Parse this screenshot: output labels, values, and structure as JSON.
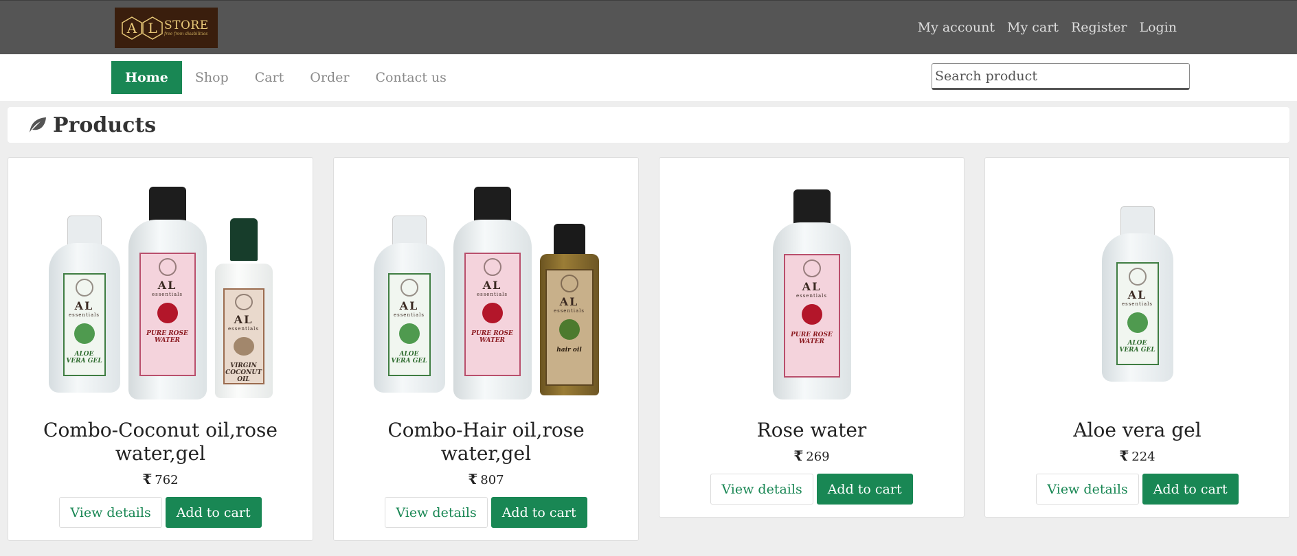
{
  "brand": {
    "logo_letters": [
      "A",
      "L"
    ],
    "logo_store": "STORE",
    "logo_tagline": "free from disabilities"
  },
  "account_links": [
    {
      "label": "My account"
    },
    {
      "label": "My cart"
    },
    {
      "label": "Register"
    },
    {
      "label": "Login"
    }
  ],
  "nav": {
    "items": [
      {
        "label": "Home",
        "active": true
      },
      {
        "label": "Shop"
      },
      {
        "label": "Cart"
      },
      {
        "label": "Order"
      },
      {
        "label": "Contact us"
      }
    ],
    "search_placeholder": "Search product"
  },
  "section": {
    "title": "Products",
    "icon": "leaf-icon"
  },
  "currency_symbol": "₹",
  "products": [
    {
      "title": "Combo-Coconut oil,rose water,gel",
      "price": "762",
      "view_label": "View details",
      "cart_label": "Add to cart"
    },
    {
      "title": "Combo-Hair oil,rose water,gel",
      "price": "807",
      "view_label": "View details",
      "cart_label": "Add to cart"
    },
    {
      "title": "Rose water",
      "price": "269",
      "view_label": "View details",
      "cart_label": "Add to cart"
    },
    {
      "title": "Aloe vera gel",
      "price": "224",
      "view_label": "View details",
      "cart_label": "Add to cart"
    }
  ],
  "colors": {
    "topbar": "#555555",
    "accent": "#198754",
    "page_bg": "#eeeeee"
  }
}
